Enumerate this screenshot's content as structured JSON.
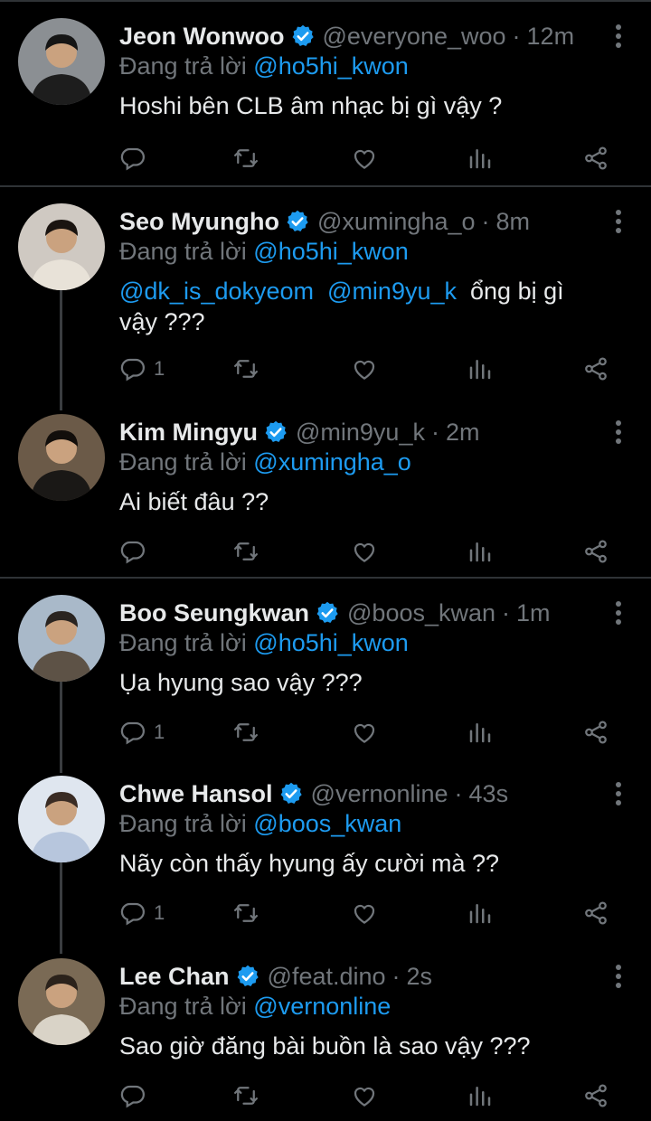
{
  "ui": {
    "reply_prefix": "Đang trả lời",
    "accent": "#1d9bf0",
    "muted": "#71767b"
  },
  "tweets": [
    {
      "name": "Jeon Wonwoo",
      "handle": "@everyone_woo",
      "time": "12m",
      "reply_to": "@ho5hi_kwon",
      "line1_mentions": [],
      "line1_text": "Hoshi bên CLB âm nhạc bị gì vậy ?",
      "line2_text": "",
      "reply_count": ""
    },
    {
      "name": "Seo Myungho",
      "handle": "@xumingha_o",
      "time": "8m",
      "reply_to": "@ho5hi_kwon",
      "line1_mentions": [
        "@dk_is_dokyeom",
        "@min9yu_k"
      ],
      "line1_text": "ổng bị gì",
      "line2_text": "vậy ???",
      "reply_count": "1"
    },
    {
      "name": "Kim Mingyu",
      "handle": "@min9yu_k",
      "time": "2m",
      "reply_to": "@xumingha_o",
      "line1_mentions": [],
      "line1_text": "Ai biết đâu ??",
      "line2_text": "",
      "reply_count": ""
    },
    {
      "name": "Boo Seungkwan",
      "handle": "@boos_kwan",
      "time": "1m",
      "reply_to": "@ho5hi_kwon",
      "line1_mentions": [],
      "line1_text": "Ụa hyung sao vậy ???",
      "line2_text": "",
      "reply_count": "1"
    },
    {
      "name": "Chwe Hansol",
      "handle": "@vernonline",
      "time": "43s",
      "reply_to": "@boos_kwan",
      "line1_mentions": [],
      "line1_text": "Nãy còn thấy hyung ấy cười mà ??",
      "line2_text": "",
      "reply_count": "1"
    },
    {
      "name": "Lee Chan",
      "handle": "@feat.dino",
      "time": "2s",
      "reply_to": "@vernonline",
      "line1_mentions": [],
      "line1_text": "Sao giờ đăng bài buồn là sao vậy ???",
      "line2_text": "",
      "reply_count": ""
    }
  ],
  "icons": [
    "reply-icon",
    "retweet-icon",
    "like-icon",
    "views-icon",
    "share-icon",
    "verified-badge-icon",
    "more-options-icon"
  ]
}
